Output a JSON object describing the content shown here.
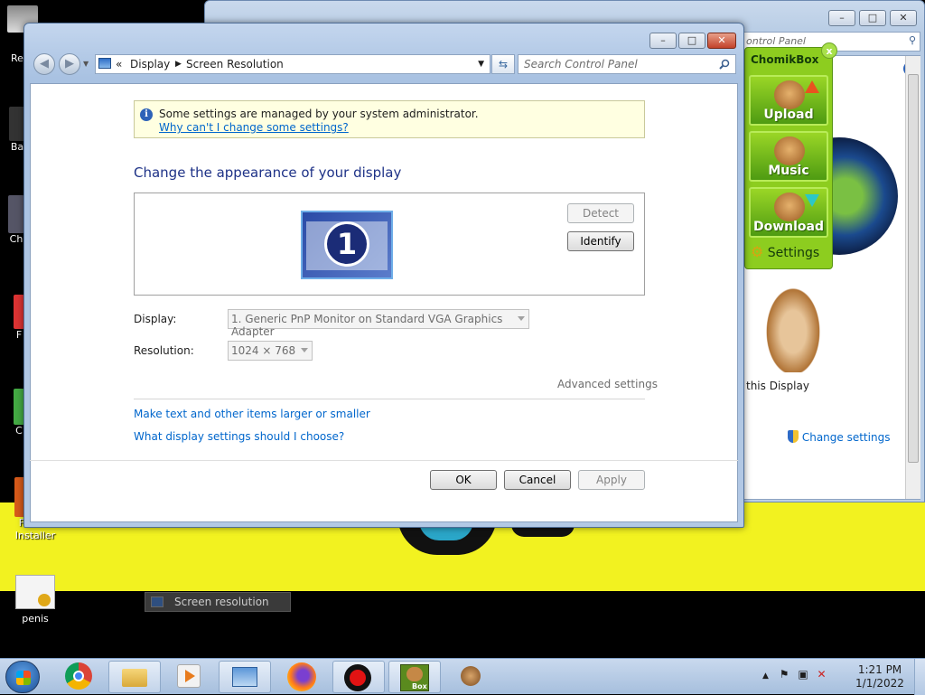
{
  "desktop": {
    "icons": [
      {
        "label": "Re"
      },
      {
        "label": "Ba"
      },
      {
        "label": "Ch"
      },
      {
        "label": "F"
      },
      {
        "label": "C"
      },
      {
        "label": "Firefox Installer"
      },
      {
        "label": "penis"
      }
    ]
  },
  "background_window": {
    "search_placeholder": "ontrol Panel",
    "content_label": "this Display",
    "link": "Change settings"
  },
  "chomikbox": {
    "title": "ChomikBox",
    "close": "x",
    "buttons": [
      "Upload",
      "Music",
      "Download"
    ],
    "settings": "Settings"
  },
  "dialog": {
    "breadcrumb": {
      "prefix": "«",
      "items": [
        "Display",
        "Screen Resolution"
      ]
    },
    "search_placeholder": "Search Control Panel",
    "info": {
      "message": "Some settings are managed by your system administrator.",
      "link": "Why can't I change some settings?"
    },
    "heading": "Change the appearance of your display",
    "monitor_number": "1",
    "detect_button": "Detect",
    "identify_button": "Identify",
    "display_label": "Display:",
    "display_value": "1. Generic PnP Monitor on Standard VGA Graphics Adapter",
    "resolution_label": "Resolution:",
    "resolution_value": "1024 × 768",
    "advanced_settings": "Advanced settings",
    "link_text_size": "Make text and other items larger or smaller",
    "link_display_help": "What display settings should I choose?",
    "ok": "OK",
    "cancel": "Cancel",
    "apply": "Apply"
  },
  "taskbar": {
    "tooltip": "Screen resolution",
    "time": "1:21 PM",
    "date": "1/1/2022"
  },
  "colors": {
    "desktop_yellow": "#f2f220",
    "link_blue": "#0066cc",
    "heading_blue": "#1e3287",
    "chomik_green": "#8dcd1f"
  }
}
